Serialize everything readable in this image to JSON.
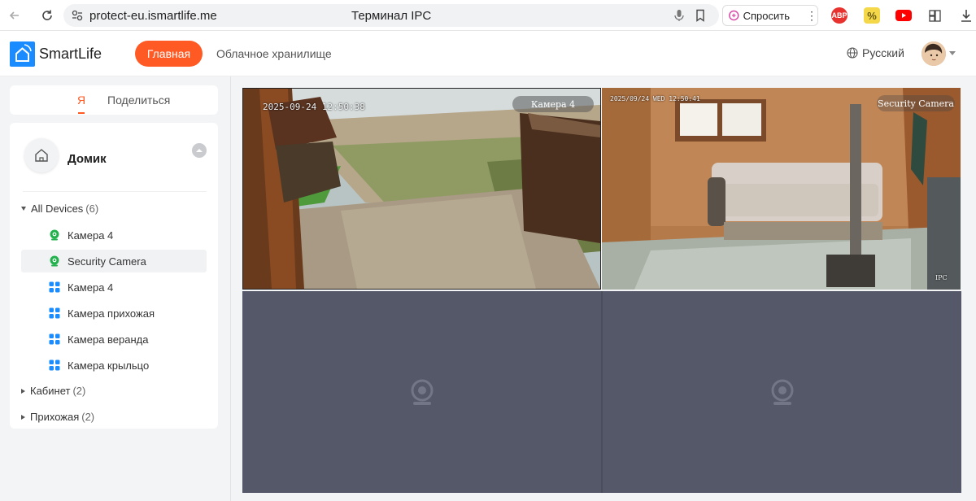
{
  "browser": {
    "url": "protect-eu.ismartlife.me",
    "page_title": "Терминал IPC",
    "ask_label": "Спросить",
    "extensions": [
      "abp-icon",
      "percent-icon",
      "youtube-icon",
      "extension-icon",
      "download-icon"
    ],
    "abp_text": "ABP"
  },
  "app": {
    "logo": "SmartLife",
    "nav": {
      "home": "Главная",
      "cloud": "Облачное хранилище"
    },
    "language": "Русский",
    "accent": "#ff5a24",
    "brand": "#1a8cff"
  },
  "sidebar": {
    "tabs": {
      "me": "Я",
      "share": "Поделиться"
    },
    "home": {
      "name": "Домик"
    },
    "groups": [
      {
        "label": "All Devices",
        "count": "(6)",
        "expanded": true
      },
      {
        "label": "Кабинет",
        "count": "(2)",
        "expanded": false
      },
      {
        "label": "Прихожая",
        "count": "(2)",
        "expanded": false
      }
    ],
    "devices": [
      {
        "label": "Камера 4",
        "icon": "camera-online-icon",
        "selected": false
      },
      {
        "label": "Security Camera",
        "icon": "camera-online-icon",
        "selected": true
      },
      {
        "label": "Камера 4",
        "icon": "device-grid-icon",
        "selected": false
      },
      {
        "label": "Камера прихожая",
        "icon": "device-grid-icon",
        "selected": false
      },
      {
        "label": "Камера веранда",
        "icon": "device-grid-icon",
        "selected": false
      },
      {
        "label": "Камера крыльцо",
        "icon": "device-grid-icon",
        "selected": false
      }
    ]
  },
  "video_grid": {
    "cells": [
      {
        "camera_label": "Камера 4",
        "timestamp": "2025-09-24 12:50:38",
        "state": "live-outdoor"
      },
      {
        "camera_label": "Security Camera",
        "timestamp": "2025/09/24 WED 12:50:41",
        "watermark": "IPC",
        "state": "live-indoor"
      },
      {
        "state": "empty"
      },
      {
        "state": "empty"
      }
    ]
  }
}
